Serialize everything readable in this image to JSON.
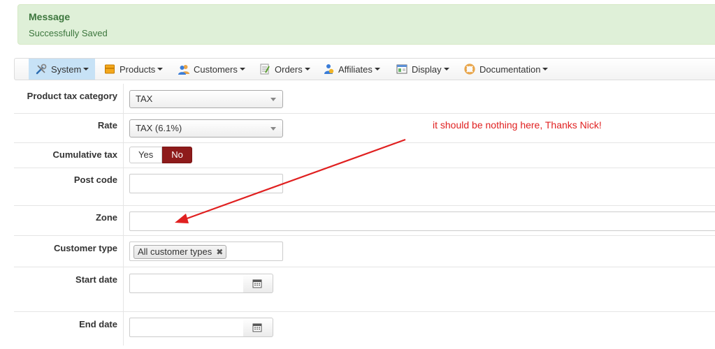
{
  "message": {
    "title": "Message",
    "text": "Successfully Saved"
  },
  "nav": [
    {
      "label": "System",
      "icon": "tools-icon"
    },
    {
      "label": "Products",
      "icon": "box-icon"
    },
    {
      "label": "Customers",
      "icon": "users-icon"
    },
    {
      "label": "Orders",
      "icon": "orders-icon"
    },
    {
      "label": "Affiliates",
      "icon": "affiliates-icon"
    },
    {
      "label": "Display",
      "icon": "display-icon"
    },
    {
      "label": "Documentation",
      "icon": "lifebuoy-icon"
    }
  ],
  "form": {
    "tax_category": {
      "label": "Product tax category",
      "value": "TAX"
    },
    "rate": {
      "label": "Rate",
      "value": "TAX (6.1%)"
    },
    "cumulative": {
      "label": "Cumulative tax",
      "yes": "Yes",
      "no": "No",
      "selected": "No"
    },
    "postcode": {
      "label": "Post code",
      "value": ""
    },
    "zone": {
      "label": "Zone",
      "value": ""
    },
    "customer_type": {
      "label": "Customer type",
      "tag": "All customer types"
    },
    "start_date": {
      "label": "Start date",
      "value": ""
    },
    "end_date": {
      "label": "End date",
      "value": ""
    }
  },
  "annotation": {
    "text": "it should be nothing here, Thanks Nick!",
    "color": "#e02020"
  },
  "colors": {
    "active_nav": "#c7e2f6",
    "no_button": "#8e1b1b",
    "success_bg": "#dff0d8"
  }
}
